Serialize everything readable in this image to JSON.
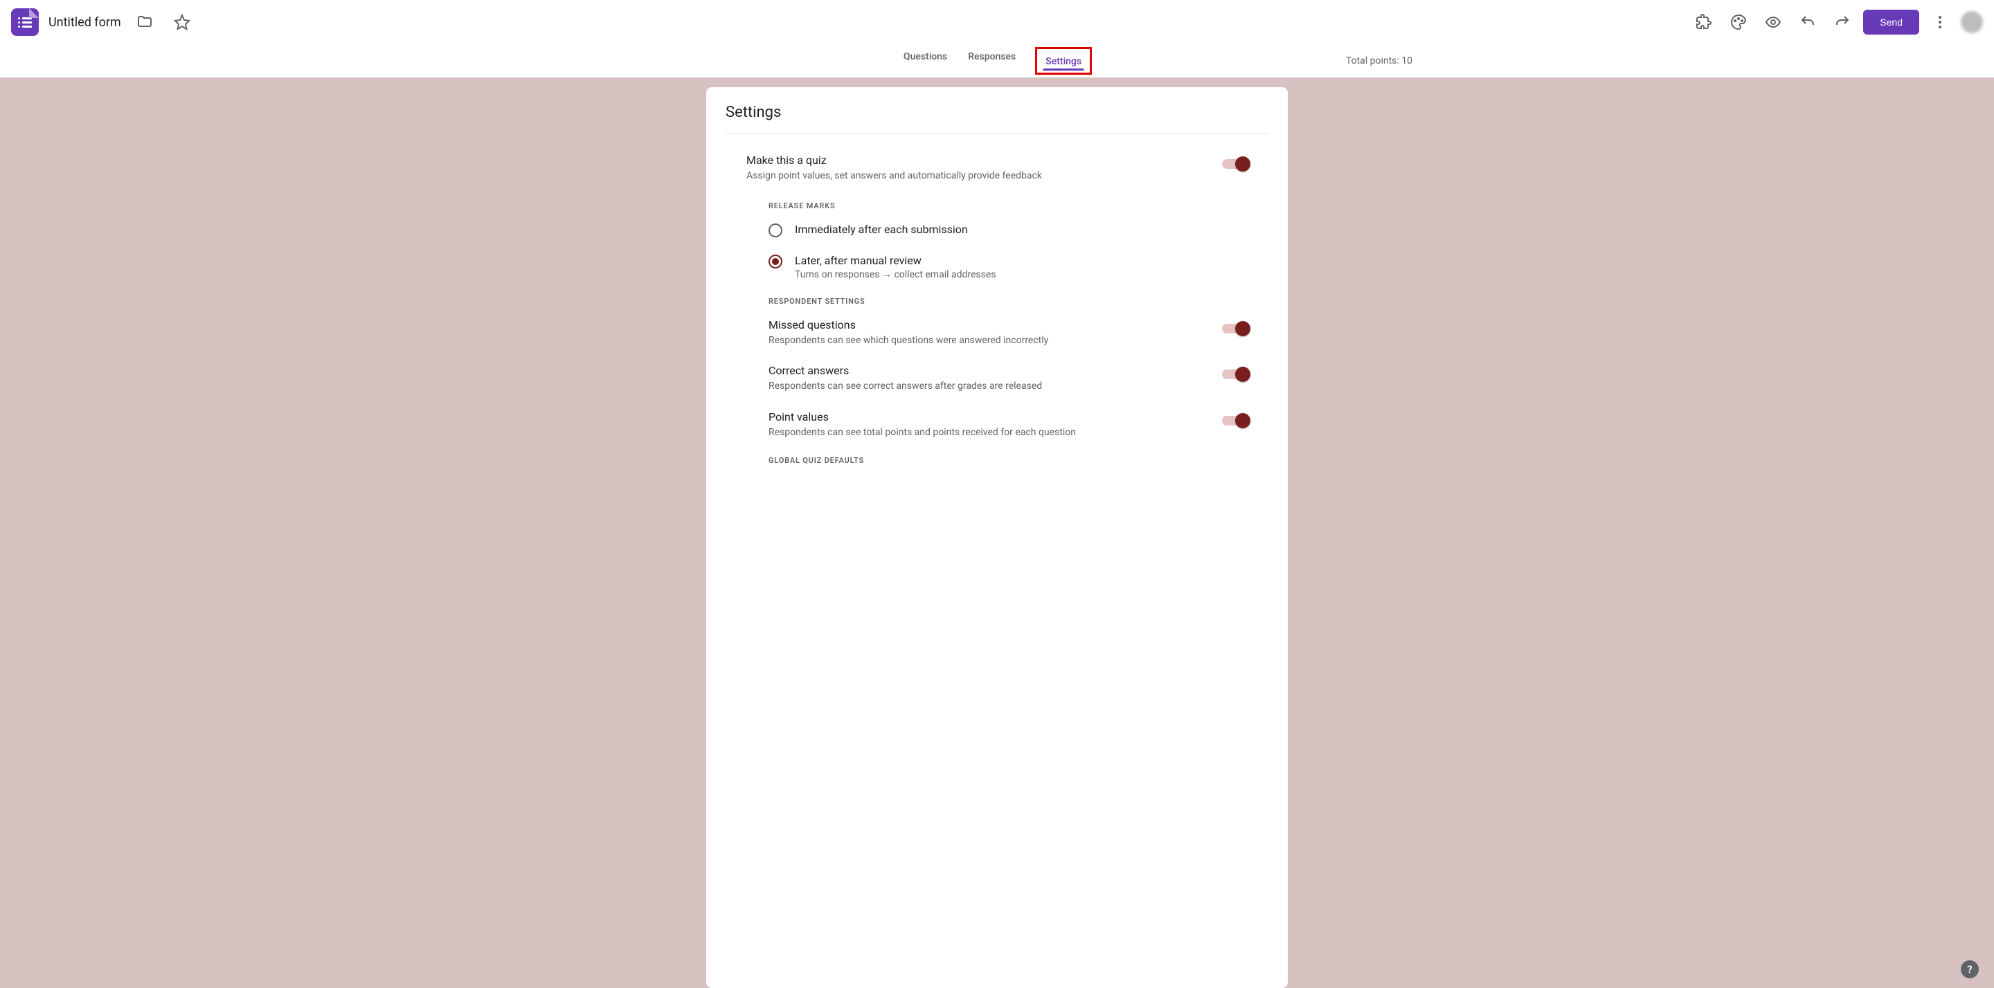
{
  "header": {
    "form_title": "Untitled form",
    "send_label": "Send"
  },
  "tabs": {
    "questions": "Questions",
    "responses": "Responses",
    "settings": "Settings",
    "active": "settings"
  },
  "total_points_label": "Total points: 10",
  "settings": {
    "card_title": "Settings",
    "make_quiz": {
      "title": "Make this a quiz",
      "desc": "Assign point values, set answers and automatically provide feedback",
      "enabled": true
    },
    "release_marks": {
      "section_label": "RELEASE MARKS",
      "options": [
        {
          "label": "Immediately after each submission",
          "desc": "",
          "selected": false
        },
        {
          "label": "Later, after manual review",
          "desc": "Turns on responses → collect email addresses",
          "selected": true
        }
      ]
    },
    "respondent": {
      "section_label": "RESPONDENT SETTINGS",
      "items": [
        {
          "title": "Missed questions",
          "desc": "Respondents can see which questions were answered incorrectly",
          "enabled": true
        },
        {
          "title": "Correct answers",
          "desc": "Respondents can see correct answers after grades are released",
          "enabled": true
        },
        {
          "title": "Point values",
          "desc": "Respondents can see total points and points received for each question",
          "enabled": true
        }
      ]
    },
    "global_defaults_label": "GLOBAL QUIZ DEFAULTS"
  },
  "icons": {
    "folder": "folder-icon",
    "star": "star-icon",
    "addon": "puzzle-icon",
    "theme": "palette-icon",
    "preview": "eye-icon",
    "undo": "undo-icon",
    "redo": "redo-icon",
    "more": "more-vert-icon",
    "help": "?"
  }
}
